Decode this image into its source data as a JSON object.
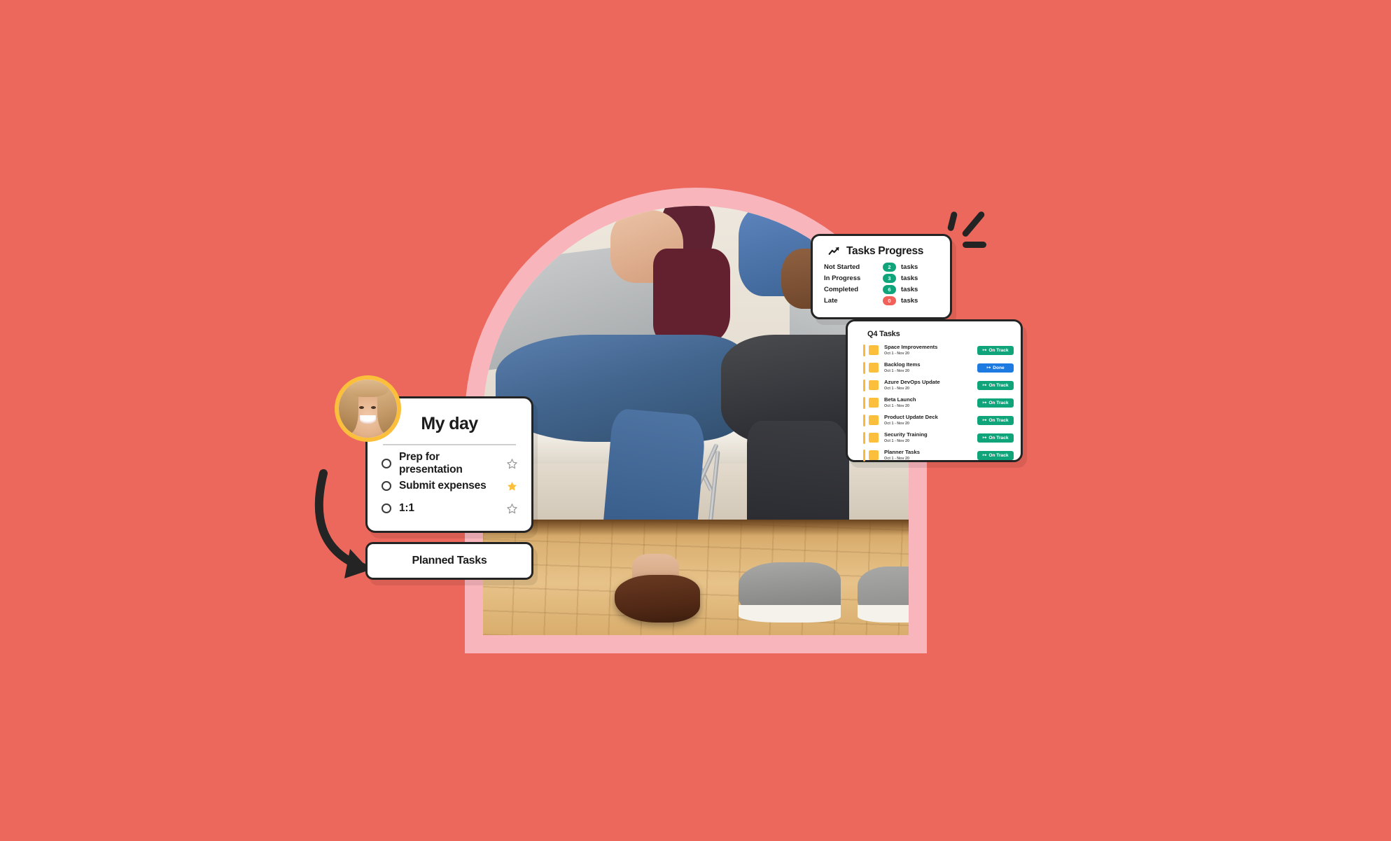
{
  "theme": {
    "background": "#EC685C",
    "arch_pink": "#F9B5BC",
    "accent_yellow": "#FBBF3C",
    "badge_green": "#0FA47A",
    "badge_blue": "#1C7AE0",
    "badge_red": "#F2605A",
    "ink": "#242424"
  },
  "decor": {
    "sparkle_name": "sparkle-burst",
    "arrow_name": "curved-arrow"
  },
  "photo": {
    "alt_name": "two-people-seated-with-laptops-photo"
  },
  "tasks_progress": {
    "icon": "trending-up-icon",
    "title": "Tasks Progress",
    "unit": "tasks",
    "rows": [
      {
        "label": "Not Started",
        "count": "2",
        "tone": "green"
      },
      {
        "label": "In Progress",
        "count": "3",
        "tone": "green"
      },
      {
        "label": "Completed",
        "count": "6",
        "tone": "green"
      },
      {
        "label": "Late",
        "count": "0",
        "tone": "red"
      }
    ]
  },
  "q4_tasks": {
    "title": "Q4 Tasks",
    "rows": [
      {
        "name": "Space Improvements",
        "dates": "Oct 1 - Nov 20",
        "status": "On Track",
        "tone": "green"
      },
      {
        "name": "Backlog Items",
        "dates": "Oct 1 - Nov 20",
        "status": "Done",
        "tone": "blue"
      },
      {
        "name": "Azure DevOps Update",
        "dates": "Oct 1 - Nov 20",
        "status": "On Track",
        "tone": "green"
      },
      {
        "name": "Beta Launch",
        "dates": "Oct 1 - Nov 20",
        "status": "On Track",
        "tone": "green"
      },
      {
        "name": "Product Update Deck",
        "dates": "Oct 1 - Nov 20",
        "status": "On Track",
        "tone": "green"
      },
      {
        "name": "Security Training",
        "dates": "Oct 1 - Nov 20",
        "status": "On Track",
        "tone": "green"
      },
      {
        "name": "Planner Tasks",
        "dates": "Oct 1 - Nov 20",
        "status": "On Track",
        "tone": "green"
      }
    ]
  },
  "my_day": {
    "title": "My day",
    "avatar_name": "user-avatar-photo",
    "items": [
      {
        "label": "Prep for presentation",
        "starred": false
      },
      {
        "label": "Submit expenses",
        "starred": true
      },
      {
        "label": "1:1",
        "starred": false
      }
    ]
  },
  "planned_tasks": {
    "label": "Planned Tasks"
  }
}
